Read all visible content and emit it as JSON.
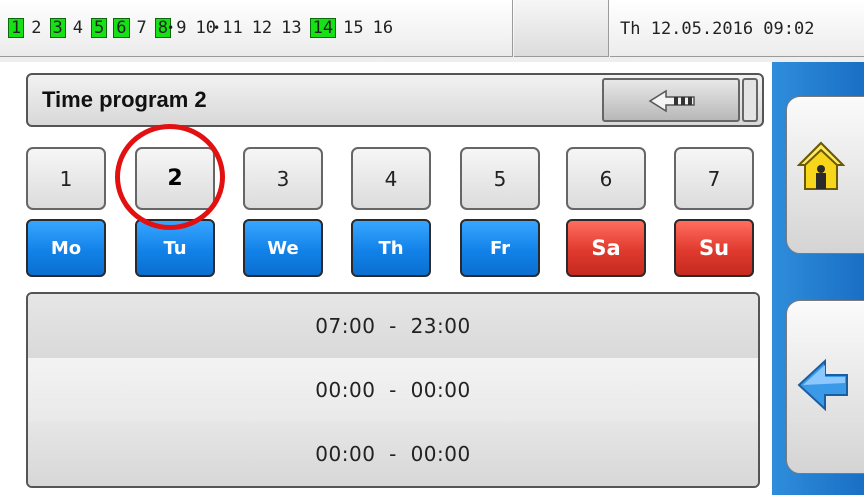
{
  "status_bar": {
    "outputs": [
      {
        "label": "1",
        "active": true
      },
      {
        "label": "2",
        "active": false
      },
      {
        "label": "3",
        "active": true
      },
      {
        "label": "4",
        "active": false
      },
      {
        "label": "5",
        "active": true
      },
      {
        "label": "6",
        "active": true
      },
      {
        "label": "7",
        "active": false
      },
      {
        "label": "8",
        "active": true
      },
      {
        "label": "9",
        "active": false
      },
      {
        "label": "10",
        "active": false
      },
      {
        "label": "11",
        "active": false
      },
      {
        "label": "12",
        "active": false
      },
      {
        "label": "13",
        "active": false
      },
      {
        "label": "14",
        "active": true
      },
      {
        "label": "15",
        "active": false
      },
      {
        "label": "16",
        "active": false
      }
    ],
    "datetime": "Th 12.05.2016 09:02",
    "active_color": "#16e016"
  },
  "header": {
    "title": "Time program 2",
    "back_icon": "arrow-left-icon"
  },
  "day_numbers": [
    "1",
    "2",
    "3",
    "4",
    "5",
    "6",
    "7"
  ],
  "selected_day_number": "2",
  "weekdays": [
    {
      "label": "Mo",
      "weekend": false
    },
    {
      "label": "Tu",
      "weekend": false
    },
    {
      "label": "We",
      "weekend": false
    },
    {
      "label": "Th",
      "weekend": false
    },
    {
      "label": "Fr",
      "weekend": false
    },
    {
      "label": "Sa",
      "weekend": true
    },
    {
      "label": "Su",
      "weekend": true
    }
  ],
  "time_slots": [
    "07:00  -  23:00",
    "00:00  -  00:00",
    "00:00  -  00:00"
  ],
  "sidebar": {
    "home_icon": "home-icon",
    "back_icon": "back-arrow-icon"
  },
  "colors": {
    "weekday_blue": "#1282e8",
    "weekend_red": "#e03a2e",
    "side_panel_blue": "#1a6fc5",
    "highlight_red": "#e21010"
  }
}
